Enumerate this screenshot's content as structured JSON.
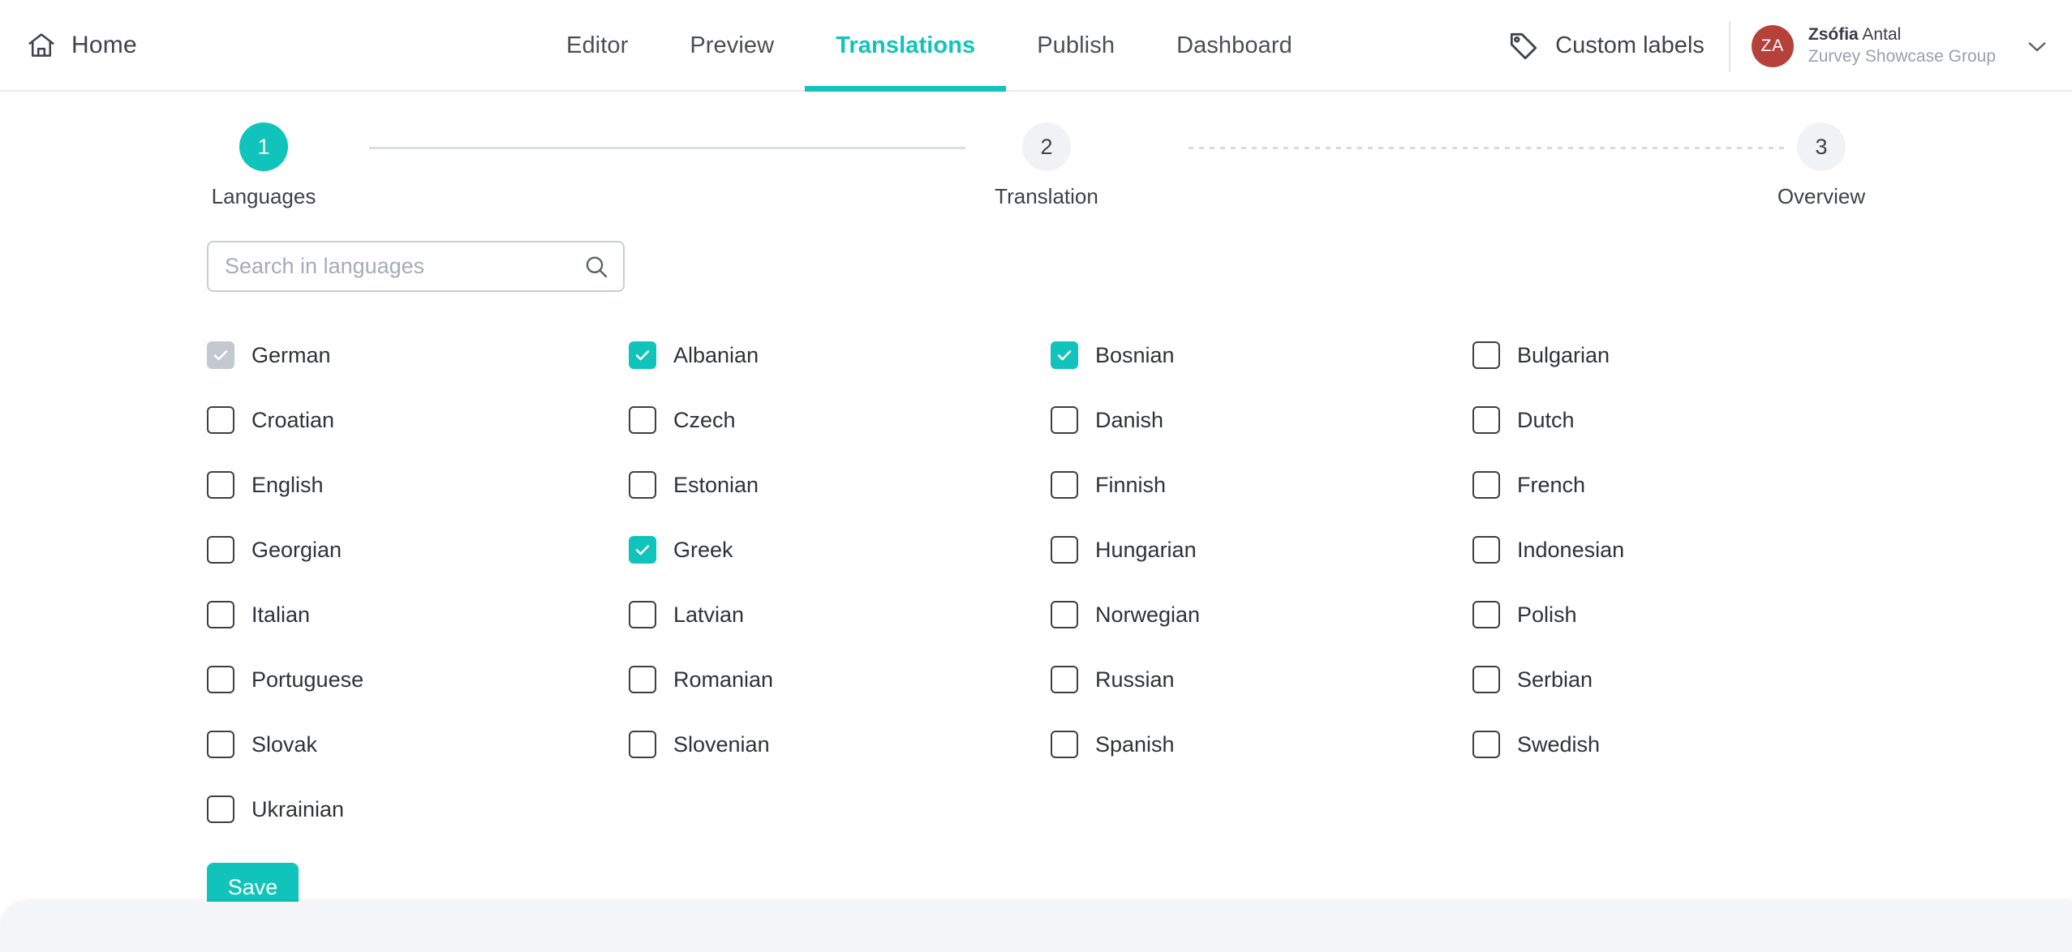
{
  "colors": {
    "accent": "#10c4bb",
    "avatar": "#b5413a",
    "text": "#3f4248",
    "muted": "#9aa0ab",
    "border": "#dcdfe6"
  },
  "topbar": {
    "home_label": "Home",
    "home_icon": "home-icon",
    "tabs": [
      {
        "label": "Editor",
        "active": false
      },
      {
        "label": "Preview",
        "active": false
      },
      {
        "label": "Translations",
        "active": true
      },
      {
        "label": "Publish",
        "active": false
      },
      {
        "label": "Dashboard",
        "active": false
      }
    ],
    "custom_labels": {
      "label": "Custom labels",
      "icon": "tag-icon"
    },
    "user": {
      "initials": "ZA",
      "first_name": "Zsófia",
      "last_name": "Antal",
      "organization": "Zurvey Showcase Group",
      "chevron_icon": "chevron-down-icon"
    }
  },
  "stepper": {
    "steps": [
      {
        "number": "1",
        "label": "Languages",
        "state": "active"
      },
      {
        "number": "2",
        "label": "Translation",
        "state": "idle"
      },
      {
        "number": "3",
        "label": "Overview",
        "state": "idle"
      }
    ],
    "connectors": [
      {
        "style": "solid"
      },
      {
        "style": "dotted"
      }
    ]
  },
  "search": {
    "placeholder": "Search in languages",
    "value": "",
    "icon": "search-icon"
  },
  "languages": [
    {
      "label": "German",
      "state": "locked"
    },
    {
      "label": "Albanian",
      "state": "checked"
    },
    {
      "label": "Bosnian",
      "state": "checked"
    },
    {
      "label": "Bulgarian",
      "state": "unchecked"
    },
    {
      "label": "Croatian",
      "state": "unchecked"
    },
    {
      "label": "Czech",
      "state": "unchecked"
    },
    {
      "label": "Danish",
      "state": "unchecked"
    },
    {
      "label": "Dutch",
      "state": "unchecked"
    },
    {
      "label": "English",
      "state": "unchecked"
    },
    {
      "label": "Estonian",
      "state": "unchecked"
    },
    {
      "label": "Finnish",
      "state": "unchecked"
    },
    {
      "label": "French",
      "state": "unchecked"
    },
    {
      "label": "Georgian",
      "state": "unchecked"
    },
    {
      "label": "Greek",
      "state": "checked"
    },
    {
      "label": "Hungarian",
      "state": "unchecked"
    },
    {
      "label": "Indonesian",
      "state": "unchecked"
    },
    {
      "label": "Italian",
      "state": "unchecked"
    },
    {
      "label": "Latvian",
      "state": "unchecked"
    },
    {
      "label": "Norwegian",
      "state": "unchecked"
    },
    {
      "label": "Polish",
      "state": "unchecked"
    },
    {
      "label": "Portuguese",
      "state": "unchecked"
    },
    {
      "label": "Romanian",
      "state": "unchecked"
    },
    {
      "label": "Russian",
      "state": "unchecked"
    },
    {
      "label": "Serbian",
      "state": "unchecked"
    },
    {
      "label": "Slovak",
      "state": "unchecked"
    },
    {
      "label": "Slovenian",
      "state": "unchecked"
    },
    {
      "label": "Spanish",
      "state": "unchecked"
    },
    {
      "label": "Swedish",
      "state": "unchecked"
    },
    {
      "label": "Ukrainian",
      "state": "unchecked"
    }
  ],
  "actions": {
    "save_label": "Save"
  }
}
